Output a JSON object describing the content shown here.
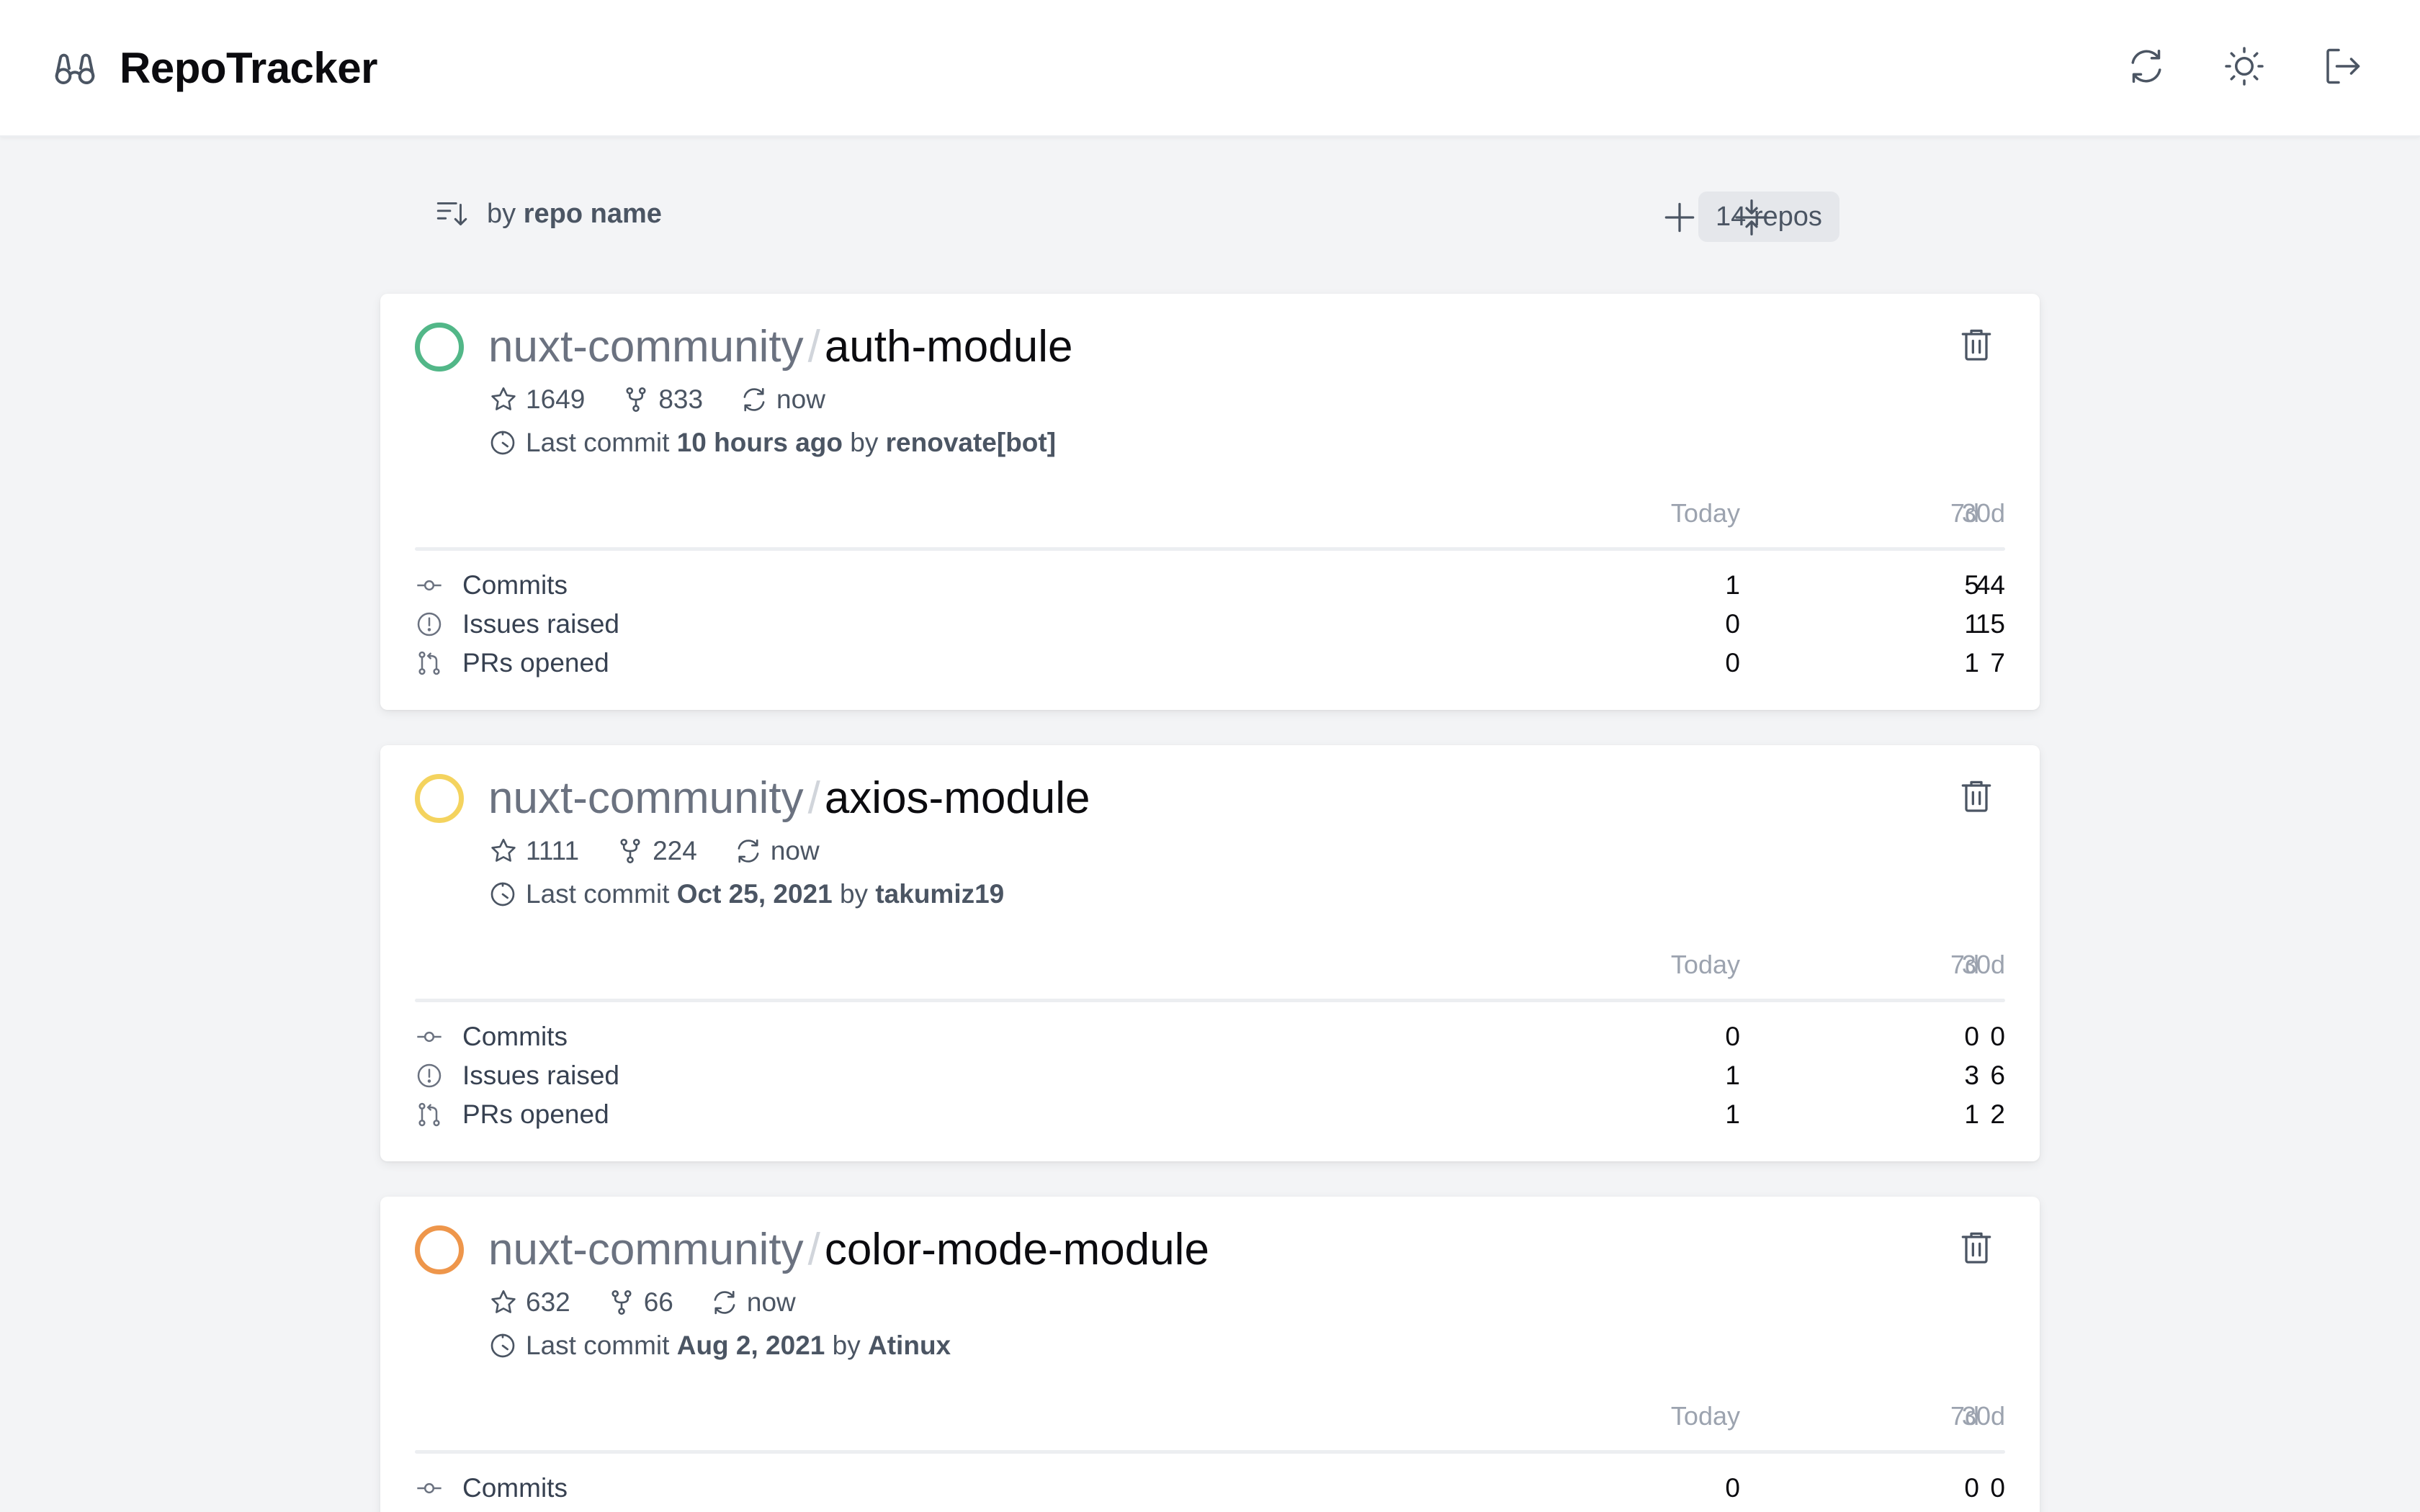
{
  "header": {
    "title": "RepoTracker",
    "logo_icon": "binoculars-icon",
    "actions": [
      {
        "name": "refresh-button",
        "icon": "refresh-icon"
      },
      {
        "name": "theme-toggle-button",
        "icon": "sun-icon"
      },
      {
        "name": "logout-button",
        "icon": "logout-icon"
      }
    ]
  },
  "toolbar": {
    "sort_prefix": "by",
    "sort_field": "repo name",
    "repo_count": "14 repos"
  },
  "columns": [
    "Today",
    "7d",
    "30d"
  ],
  "row_labels": [
    "Commits",
    "Issues raised",
    "PRs opened"
  ],
  "colors": {
    "green": "#52b788",
    "yellow": "#f4d35e",
    "orange": "#ee964b"
  },
  "repos": [
    {
      "owner": "nuxt-community",
      "name": "auth-module",
      "status_color": "#52b788",
      "stars": "1649",
      "forks": "833",
      "synced": "now",
      "last_commit_prefix": "Last commit",
      "last_commit_time": "10 hours ago",
      "by": "by",
      "last_commit_author": "renovate[bot]",
      "commits": [
        "1",
        "5",
        "44"
      ],
      "issues": [
        "0",
        "1",
        "15"
      ],
      "prs": [
        "0",
        "1",
        "7"
      ]
    },
    {
      "owner": "nuxt-community",
      "name": "axios-module",
      "status_color": "#f4d35e",
      "stars": "1111",
      "forks": "224",
      "synced": "now",
      "last_commit_prefix": "Last commit",
      "last_commit_time": "Oct 25, 2021",
      "by": "by",
      "last_commit_author": "takumiz19",
      "commits": [
        "0",
        "0",
        "0"
      ],
      "issues": [
        "1",
        "3",
        "6"
      ],
      "prs": [
        "1",
        "1",
        "2"
      ]
    },
    {
      "owner": "nuxt-community",
      "name": "color-mode-module",
      "status_color": "#ee964b",
      "stars": "632",
      "forks": "66",
      "synced": "now",
      "last_commit_prefix": "Last commit",
      "last_commit_time": "Aug 2, 2021",
      "by": "by",
      "last_commit_author": "Atinux",
      "commits": [
        "0",
        "0",
        "0"
      ],
      "issues": [],
      "prs": []
    }
  ]
}
